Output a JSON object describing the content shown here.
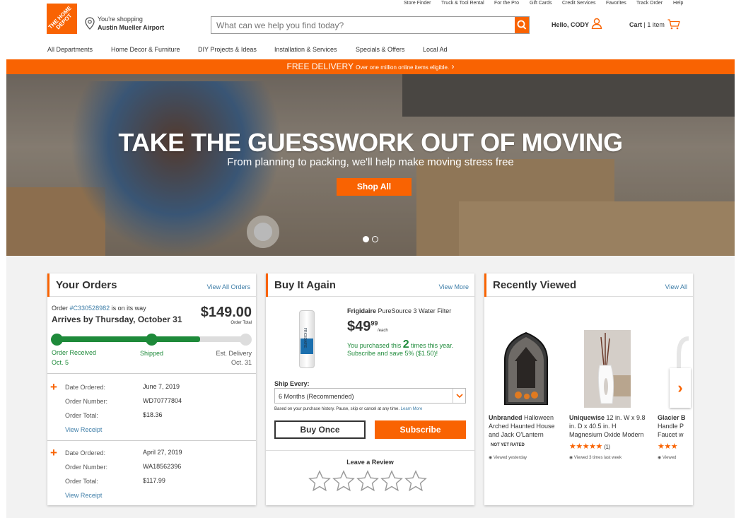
{
  "utility_nav": [
    "Store Finder",
    "Truck & Tool Rental",
    "For the Pro",
    "Gift Cards",
    "Credit Services",
    "Favorites",
    "Track Order",
    "Help"
  ],
  "logo": {
    "text": "THE HOME DEPOT",
    "color": "#f96302"
  },
  "location": {
    "line1": "You're shopping",
    "store": "Austin Mueller Airport"
  },
  "search": {
    "placeholder": "What can we help you find today?"
  },
  "account": {
    "greeting": "Hello, CODY"
  },
  "cart": {
    "label": "Cart",
    "separator": "|",
    "count_text": "1 item"
  },
  "main_nav": [
    "All Departments",
    "Home Decor & Furniture",
    "DIY Projects & Ideas",
    "Installation & Services",
    "Specials & Offers",
    "Local Ad"
  ],
  "promo": {
    "headline": "FREE DELIVERY",
    "detail": "Over one million online items eligible.",
    "arrow": "›"
  },
  "hero": {
    "title": "TAKE THE GUESSWORK OUT OF MOVING",
    "subtitle": "From planning to packing, we'll help make moving stress free",
    "cta": "Shop All",
    "slides": 2,
    "active_slide": 1
  },
  "orders": {
    "title": "Your Orders",
    "view_all": "View All Orders",
    "current": {
      "order_prefix": "Order",
      "order_number": "#C330528982",
      "status": "is on its way",
      "arrival": "Arrives by Thursday, October 31",
      "total": "$149.00",
      "total_label": "Order Total",
      "progress_steps_completed": 2,
      "steps": [
        {
          "label": "Order Received",
          "date": "Oct. 5"
        },
        {
          "label": "Shipped",
          "date": ""
        },
        {
          "label": "Est. Delivery",
          "date": "Oct. 31"
        }
      ]
    },
    "past": [
      {
        "date_label": "Date Ordered:",
        "date": "June 7, 2019",
        "number_label": "Order Number:",
        "number": "WD70777804",
        "total_label": "Order Total:",
        "total": "$18.36",
        "receipt": "View Receipt"
      },
      {
        "date_label": "Date Ordered:",
        "date": "April 27, 2019",
        "number_label": "Order Number:",
        "number": "WA18562396",
        "total_label": "Order Total:",
        "total": "$117.99",
        "receipt": "View Receipt"
      }
    ]
  },
  "buy_again": {
    "title": "Buy It Again",
    "view_more": "View More",
    "product": {
      "brand": "Frigidaire",
      "name": "PureSource 3 Water Filter",
      "image_label": "FRIGIDAIRE",
      "price_dollars": "$49",
      "price_cents": "99",
      "price_unit": "/each",
      "purchase_prefix": "You purchased this",
      "purchase_count": "2",
      "purchase_suffix": "times this year.",
      "subscribe_note": "Subscribe and save 5% ($1.50)!"
    },
    "ship_every_label": "Ship Every:",
    "ship_every_value": "6 Months (Recommended)",
    "ship_note": "Based on your purchase history. Pause, skip or cancel at any time.",
    "learn_more": "Learn More",
    "buy_once": "Buy Once",
    "subscribe": "Subscribe",
    "review_title": "Leave a Review",
    "review_stars": 5
  },
  "recently_viewed": {
    "title": "Recently Viewed",
    "view_all": "View All",
    "items": [
      {
        "brand": "Unbranded",
        "line1": "Halloween",
        "line2": "Arched Haunted House",
        "line3": "and Jack O'Lantern",
        "rating_text": "NOT YET RATED",
        "viewed": "Viewed yesterday"
      },
      {
        "brand": "Uniquewise",
        "line1": "12 in. W x 9.8",
        "line2": "in. D x 40.5 in. H",
        "line3": "Magnesium Oxide Modern",
        "rating": 5,
        "rating_count": "(1)",
        "viewed": "Viewed 3 times last week"
      },
      {
        "brand": "Glacier B",
        "line1": "",
        "line2": "Handle P",
        "line3": "Faucet w",
        "rating": 3,
        "viewed": "Viewed"
      }
    ],
    "next_arrow": "›"
  }
}
